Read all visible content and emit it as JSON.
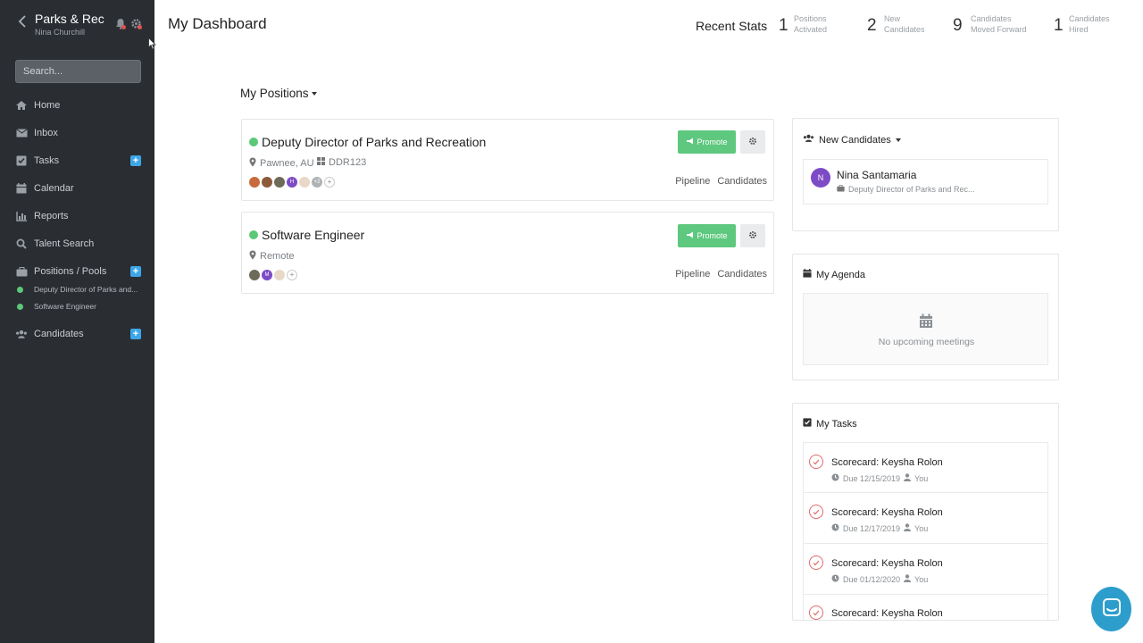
{
  "sidebar": {
    "title": "Parks & Rec",
    "user": "Nina Churchill",
    "search_placeholder": "Search...",
    "items": [
      {
        "label": "Home",
        "icon": "home-icon"
      },
      {
        "label": "Inbox",
        "icon": "envelope-icon"
      },
      {
        "label": "Tasks",
        "icon": "checkbox-icon"
      },
      {
        "label": "Calendar",
        "icon": "calendar-icon"
      },
      {
        "label": "Reports",
        "icon": "bar-chart-icon"
      },
      {
        "label": "Talent Search",
        "icon": "search-icon"
      },
      {
        "label": "Positions / Pools",
        "icon": "briefcase-icon"
      },
      {
        "label": "Candidates",
        "icon": "users-icon"
      }
    ],
    "positions": [
      {
        "label": "Deputy Director of Parks and..."
      },
      {
        "label": "Software Engineer"
      }
    ]
  },
  "header": {
    "title": "My Dashboard",
    "recent_stats_label": "Recent Stats",
    "stats": [
      {
        "value": "1",
        "line1": "Positions",
        "line2": "Activated"
      },
      {
        "value": "2",
        "line1": "New",
        "line2": "Candidates"
      },
      {
        "value": "9",
        "line1": "Candidates",
        "line2": "Moved Forward"
      },
      {
        "value": "1",
        "line1": "Candidates",
        "line2": "Hired"
      }
    ]
  },
  "positions": {
    "heading": "My Positions",
    "cards": [
      {
        "title": "Deputy Director of Parks and Recreation",
        "location": "Pawnee, AU",
        "code": "DDR123",
        "promote": "Promote",
        "pipeline": "Pipeline",
        "candidates": "Candidates",
        "avatar_initials": [
          "H",
          "+2"
        ]
      },
      {
        "title": "Software Engineer",
        "location": "Remote",
        "promote": "Promote",
        "pipeline": "Pipeline",
        "candidates": "Candidates",
        "avatar_initials": [
          "M"
        ]
      }
    ]
  },
  "new_candidates": {
    "title": "New Candidates",
    "items": [
      {
        "initial": "N",
        "name": "Nina Santamaria",
        "position": "Deputy Director of Parks and Rec..."
      }
    ]
  },
  "agenda": {
    "title": "My Agenda",
    "empty": "No upcoming meetings"
  },
  "tasks": {
    "title": "My Tasks",
    "items": [
      {
        "title": "Scorecard: Keysha Rolon",
        "due": "Due 12/15/2019",
        "owner": "You"
      },
      {
        "title": "Scorecard: Keysha Rolon",
        "due": "Due 12/17/2019",
        "owner": "You"
      },
      {
        "title": "Scorecard: Keysha Rolon",
        "due": "Due 01/12/2020",
        "owner": "You"
      },
      {
        "title": "Scorecard: Keysha Rolon",
        "due": "",
        "owner": ""
      }
    ]
  },
  "colors": {
    "sidebar_bg": "#2a2e33",
    "accent_green": "#5ec87f",
    "plus_blue": "#3ea6e8",
    "chat_blue": "#2d9ecb"
  }
}
